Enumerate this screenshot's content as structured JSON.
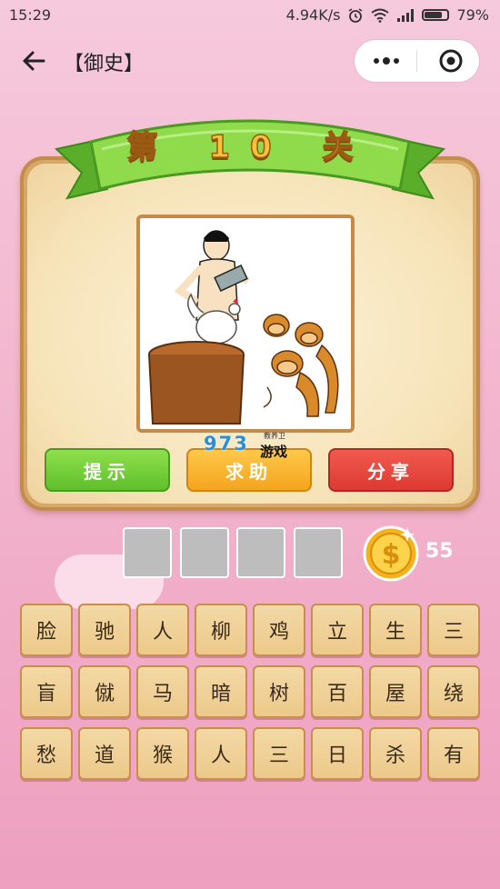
{
  "status": {
    "time": "15:29",
    "speed": "4.94K/s",
    "battery": "79%",
    "battery_level": 0.79
  },
  "nav": {
    "title": "【御史】"
  },
  "level": {
    "label": "第 10 关"
  },
  "buttons": {
    "hint": "提示",
    "help": "求助",
    "share": "分享"
  },
  "watermark": {
    "number": "973",
    "text": "游戏",
    "small": "教养卫"
  },
  "answer_slots": [
    "",
    "",
    "",
    ""
  ],
  "coins": "55",
  "characters": [
    [
      "脸",
      "驰",
      "人",
      "柳",
      "鸡",
      "立",
      "生",
      "三"
    ],
    [
      "盲",
      "僦",
      "马",
      "暗",
      "树",
      "百",
      "屋",
      "绕"
    ],
    [
      "愁",
      "道",
      "猴",
      "人",
      "三",
      "日",
      "杀",
      "有"
    ]
  ],
  "colors": {
    "hint": "#6cca33",
    "help": "#f8b530",
    "share": "#e2453b",
    "ribbon": "#7dd13f"
  }
}
